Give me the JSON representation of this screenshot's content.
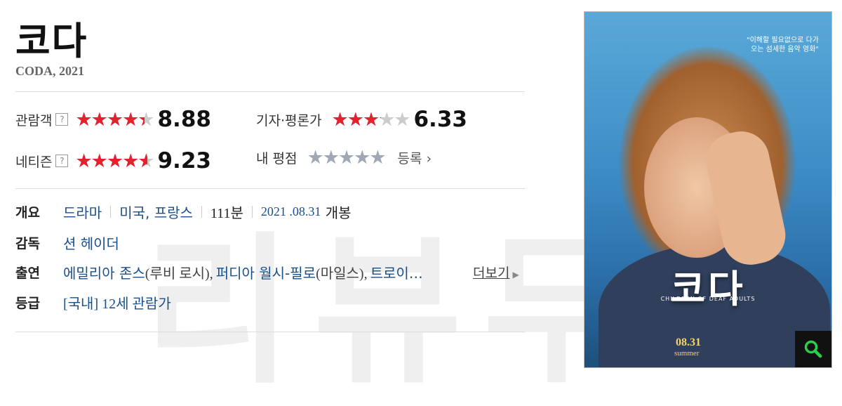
{
  "movie": {
    "title": "코다",
    "subtitle": "CODA, 2021"
  },
  "ratings": {
    "audience": {
      "label": "관람객",
      "help": "?",
      "score": "8.88",
      "fill": 0.888
    },
    "critics": {
      "label": "기자·평론가",
      "score": "6.33",
      "fill": 0.633
    },
    "netizen": {
      "label": "네티즌",
      "help": "?",
      "score": "9.23",
      "fill": 0.923
    },
    "mine": {
      "label": "내 평점",
      "register": "등록",
      "fill": 0
    },
    "star_glyphs": "★★★★★",
    "colors": {
      "filled": "#e3212f",
      "empty": "#cccccc",
      "mine": "#9fa8b3"
    }
  },
  "info": {
    "overview": {
      "label": "개요",
      "genre": "드라마",
      "country": "미국, 프랑스",
      "runtime": "111분",
      "release_date": "2021 .08.31",
      "release_suffix": " 개봉"
    },
    "director": {
      "label": "감독",
      "name": "션 헤이더"
    },
    "cast": {
      "label": "출연",
      "actor1": "에밀리아 존스",
      "role1": "(루비 로시),",
      "actor2": "퍼디아 월시-필로",
      "role2": "(마일스),",
      "actor3": "트로이…",
      "more": "더보기"
    },
    "grade": {
      "label": "등급",
      "value": "[국내] 12세 관람가"
    }
  },
  "watermark": "리뷰무",
  "poster": {
    "title": "코다",
    "subtitle": "CHILDREN OF DEAF ADULTS",
    "quote": "\"이해할 필요없으로 다가오는 섬세한 음악 영화\"",
    "date": "08.31",
    "season": "summer",
    "zoom_icon": "search-icon"
  }
}
